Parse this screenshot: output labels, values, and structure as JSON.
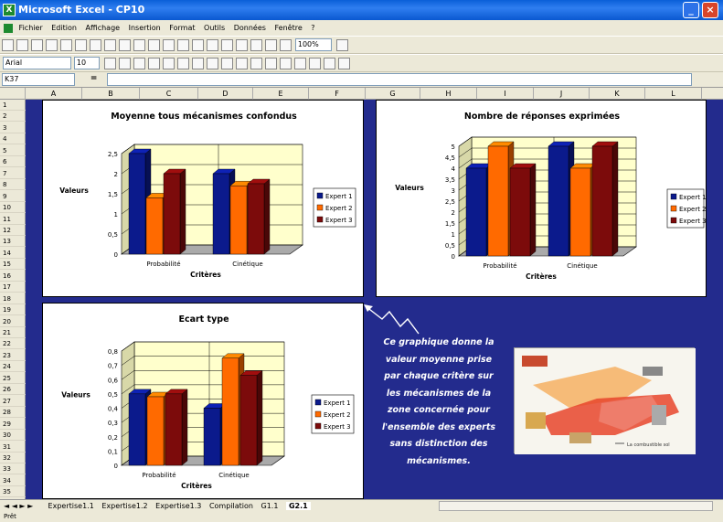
{
  "window": {
    "title": "Microsoft Excel - CP10",
    "app_icon": "excel-icon"
  },
  "menu": [
    "Fichier",
    "Edition",
    "Affichage",
    "Insertion",
    "Format",
    "Outils",
    "Données",
    "Fenêtre",
    "?"
  ],
  "toolbar": {
    "zoom": "100%"
  },
  "formatting": {
    "font": "Arial",
    "size": "10"
  },
  "formula_bar": {
    "name_box": "K37",
    "equals": "="
  },
  "columns": [
    "A",
    "B",
    "C",
    "D",
    "E",
    "F",
    "G",
    "H",
    "I",
    "J",
    "K",
    "L"
  ],
  "rows": [
    "1",
    "2",
    "3",
    "4",
    "5",
    "6",
    "7",
    "8",
    "9",
    "10",
    "11",
    "12",
    "13",
    "14",
    "15",
    "16",
    "17",
    "18",
    "19",
    "20",
    "21",
    "22",
    "23",
    "24",
    "25",
    "26",
    "27",
    "28",
    "29",
    "30",
    "31",
    "32",
    "33",
    "34",
    "35"
  ],
  "sheet_tabs": [
    "Expertise1.1",
    "Expertise1.2",
    "Expertise1.3",
    "Compilation",
    "G1.1",
    "G2.1"
  ],
  "active_tab": "G2.1",
  "status": "Prêt",
  "note_lines": [
    "Ce graphique donne la",
    "valeur moyenne prise",
    "par chaque critère sur",
    "les mécanismes de la",
    "zone concernée pour",
    "l'ensemble des experts",
    "sans distinction des",
    "mécanismes."
  ],
  "diagram_label": "La combustible sol",
  "colors": {
    "expert1": "#0b1a8c",
    "expert2": "#ff6a00",
    "expert3": "#7c0b0b",
    "wall": "#ffffcc",
    "sheet_bg": "#232b8d"
  },
  "chart_data": [
    {
      "type": "bar",
      "title": "Moyenne tous mécanismes confondus",
      "xlabel": "Critères",
      "ylabel": "Valeurs",
      "categories": [
        "Probabilité",
        "Cinétique"
      ],
      "yticks": [
        "0",
        "0,5",
        "1",
        "1,5",
        "2",
        "2,5"
      ],
      "ylim": [
        0,
        2.5
      ],
      "series": [
        {
          "name": "Expert 1",
          "values": [
            2.5,
            2.0
          ]
        },
        {
          "name": "Expert 2",
          "values": [
            1.4,
            1.7
          ]
        },
        {
          "name": "Expert 3",
          "values": [
            2.0,
            1.75
          ]
        }
      ],
      "legend": "right"
    },
    {
      "type": "bar",
      "title": "Nombre de réponses exprimées",
      "xlabel": "Critères",
      "ylabel": "Valeurs",
      "categories": [
        "Probabilité",
        "Cinétique"
      ],
      "yticks": [
        "0",
        "0,5",
        "1",
        "1,5",
        "2",
        "2,5",
        "3",
        "3,5",
        "4",
        "4,5",
        "5"
      ],
      "ylim": [
        0,
        5
      ],
      "series": [
        {
          "name": "Expert 1",
          "values": [
            4,
            5
          ]
        },
        {
          "name": "Expert 2",
          "values": [
            5,
            4
          ]
        },
        {
          "name": "Expert 3",
          "values": [
            4,
            5
          ]
        }
      ],
      "legend": "right"
    },
    {
      "type": "bar",
      "title": "Ecart type",
      "xlabel": "Critères",
      "ylabel": "Valeurs",
      "categories": [
        "Probabilité",
        "Cinétique"
      ],
      "yticks": [
        "0",
        "0,1",
        "0,2",
        "0,3",
        "0,4",
        "0,5",
        "0,6",
        "0,7",
        "0,8"
      ],
      "ylim": [
        0,
        0.8
      ],
      "series": [
        {
          "name": "Expert 1",
          "values": [
            0.5,
            0.4
          ]
        },
        {
          "name": "Expert 2",
          "values": [
            0.48,
            0.75
          ]
        },
        {
          "name": "Expert 3",
          "values": [
            0.5,
            0.63
          ]
        }
      ],
      "legend": "right"
    }
  ]
}
